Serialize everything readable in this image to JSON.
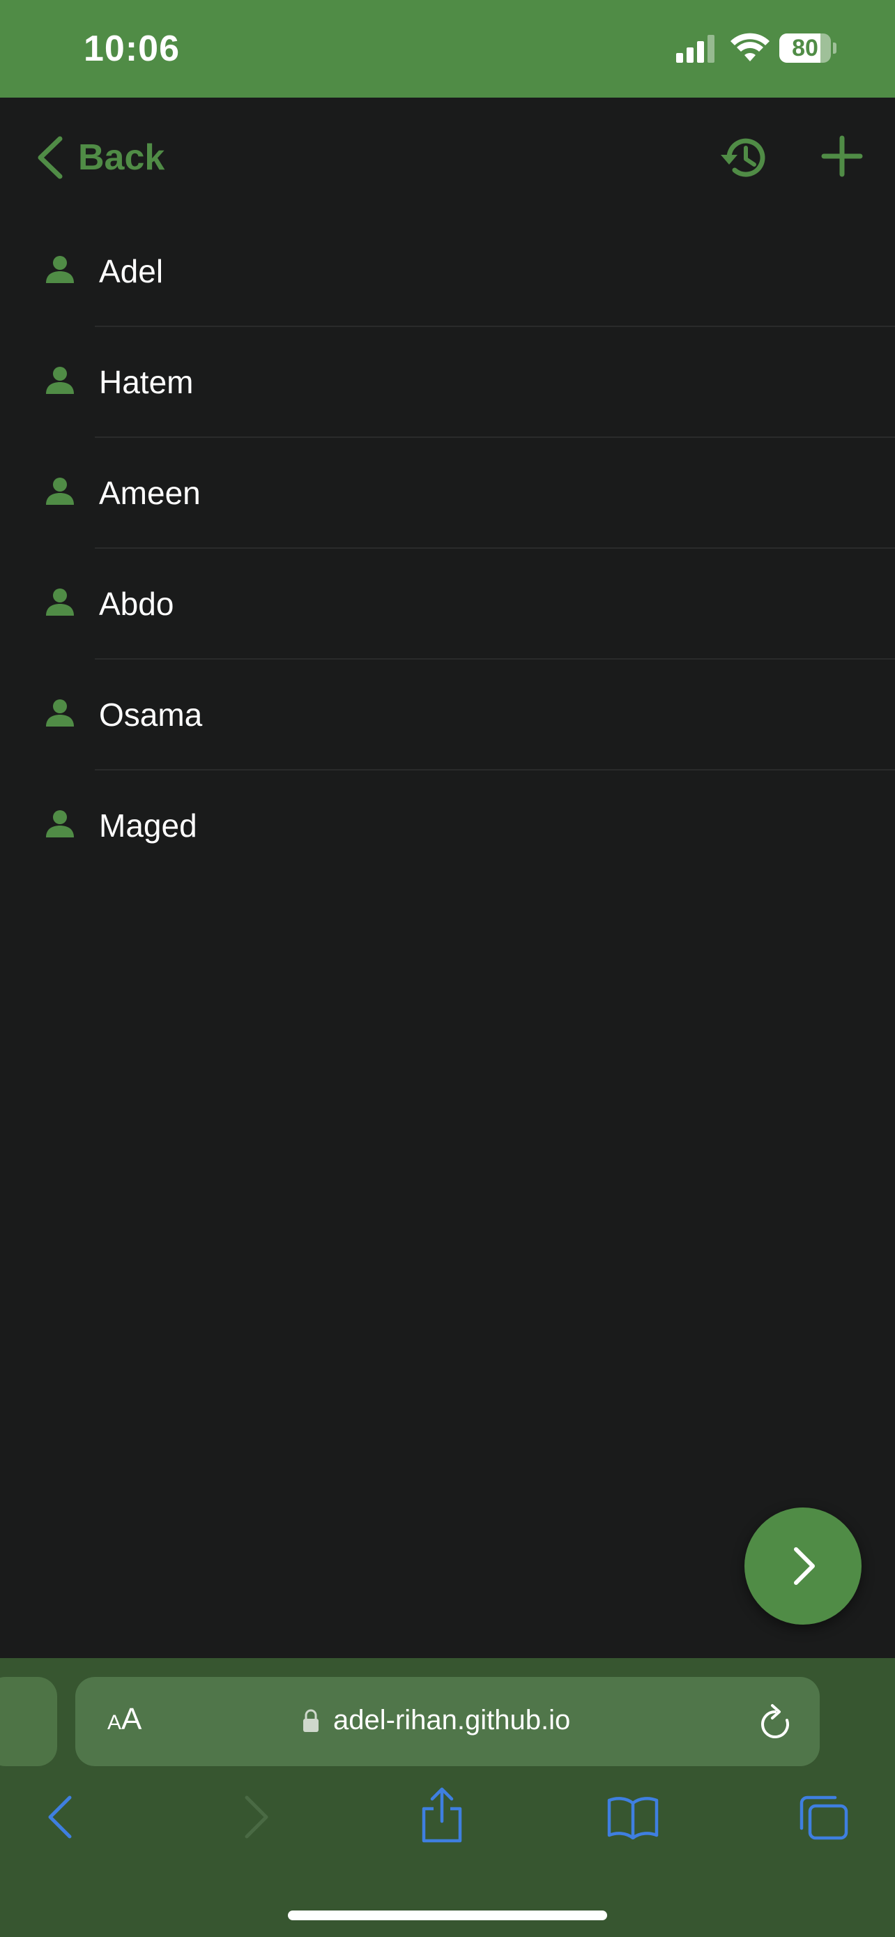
{
  "status_bar": {
    "time": "10:06",
    "battery_percent": "80",
    "battery_level": 0.8,
    "background_color": "#508c46"
  },
  "nav": {
    "back_label": "Back",
    "back_icon": "chevron-left-icon",
    "history_icon": "history-icon",
    "add_icon": "plus-icon",
    "accent_color": "#508c46"
  },
  "people": [
    {
      "name": "Adel",
      "icon": "person-icon"
    },
    {
      "name": "Hatem",
      "icon": "person-icon"
    },
    {
      "name": "Ameen",
      "icon": "person-icon"
    },
    {
      "name": "Abdo",
      "icon": "person-icon"
    },
    {
      "name": "Osama",
      "icon": "person-icon"
    },
    {
      "name": "Maged",
      "icon": "person-icon"
    }
  ],
  "fab": {
    "icon": "chevron-right-icon"
  },
  "browser": {
    "text_size_label_small": "A",
    "text_size_label_large": "A",
    "url": "adel-rihan.github.io",
    "toolbar": [
      "back-icon",
      "forward-icon",
      "share-icon",
      "bookmarks-icon",
      "tabs-icon"
    ],
    "toolbar_color": "#3f7fe0"
  }
}
